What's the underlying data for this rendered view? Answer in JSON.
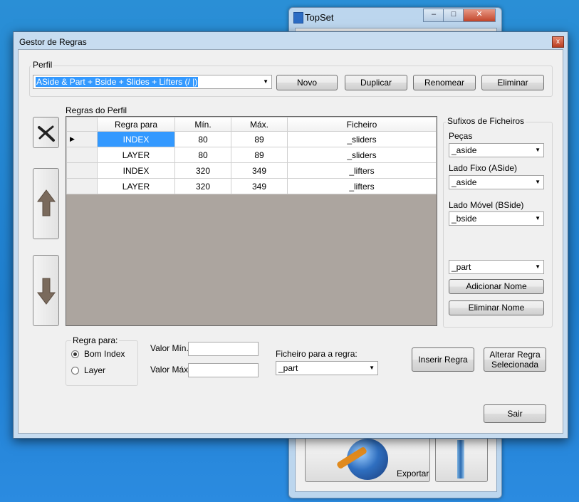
{
  "background_window": {
    "title": "TopSet",
    "export_label": "Exportar",
    "controls": [
      "–",
      "□",
      "✕"
    ]
  },
  "dialog": {
    "title": "Gestor de Regras",
    "close_glyph": "x"
  },
  "perfil": {
    "group_label": "Perfil",
    "selected": "ASide & Part + Bside + Slides + Lifters (/ |)",
    "buttons": {
      "novo": "Novo",
      "duplicar": "Duplicar",
      "renomear": "Renomear",
      "eliminar": "Eliminar"
    }
  },
  "grid": {
    "label": "Regras do Perfil",
    "columns": [
      "Regra para",
      "Mín.",
      "Máx.",
      "Ficheiro"
    ],
    "rows": [
      [
        "INDEX",
        "80",
        "89",
        "_sliders"
      ],
      [
        "LAYER",
        "80",
        "89",
        "_sliders"
      ],
      [
        "INDEX",
        "320",
        "349",
        "_lifters"
      ],
      [
        "LAYER",
        "320",
        "349",
        "_lifters"
      ]
    ],
    "current_row_marker": "▶"
  },
  "sufixos": {
    "group_label": "Sufixos de Ficheiros",
    "pecas_label": "Peças",
    "pecas_value": "_aside",
    "lado_fixo_label": "Lado Fixo (ASide)",
    "lado_fixo_value": "_aside",
    "lado_movel_label": "Lado Móvel (BSide)",
    "lado_movel_value": "_bside",
    "name_value": "_part",
    "add_name": "Adicionar Nome",
    "remove_name": "Eliminar Nome"
  },
  "regra_para": {
    "group_label": "Regra para:",
    "options": [
      "Bom Index",
      "Layer"
    ],
    "selected": "Bom Index"
  },
  "valores": {
    "min_label": "Valor Mín.",
    "max_label": "Valor Máx.",
    "min_value": "",
    "max_value": ""
  },
  "ficheiro_regra": {
    "label": "Ficheiro para a regra:",
    "value": "_part"
  },
  "actions": {
    "inserir": "Inserir Regra",
    "alterar_line1": "Alterar Regra",
    "alterar_line2": "Selecionada",
    "sair": "Sair"
  }
}
